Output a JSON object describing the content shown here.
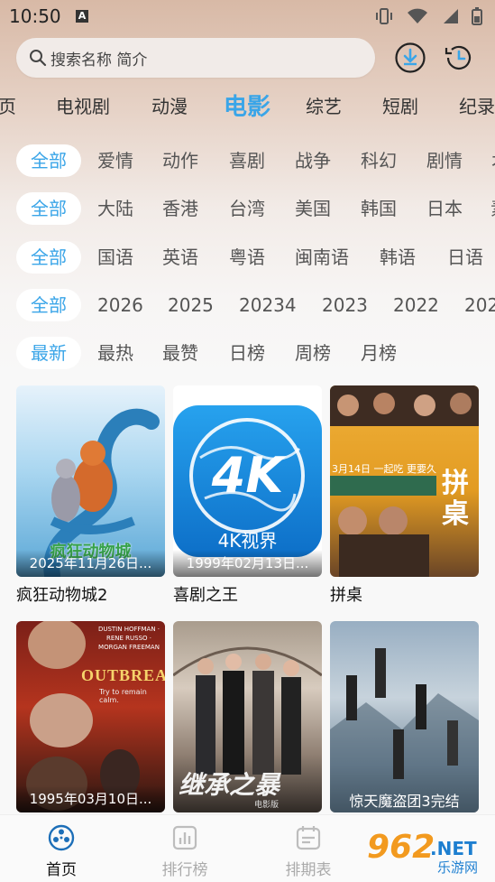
{
  "status": {
    "time": "10:50",
    "badge": "A"
  },
  "search": {
    "placeholder": "搜索名称 简介"
  },
  "categories": [
    "页",
    "电视剧",
    "动漫",
    "电影",
    "综艺",
    "短剧",
    "纪录"
  ],
  "category_active": "电影",
  "filters": {
    "genre": [
      "全部",
      "爱情",
      "动作",
      "喜剧",
      "战争",
      "科幻",
      "剧情",
      "オ"
    ],
    "region": [
      "全部",
      "大陆",
      "香港",
      "台湾",
      "美国",
      "韩国",
      "日本",
      "素"
    ],
    "language": [
      "全部",
      "国语",
      "英语",
      "粤语",
      "闽南语",
      "韩语",
      "日语"
    ],
    "year": [
      "全部",
      "2026",
      "2025",
      "20234",
      "2023",
      "2022",
      "202"
    ],
    "sort": [
      "最新",
      "最热",
      "最赞",
      "日榜",
      "周榜",
      "月榜"
    ]
  },
  "movies": [
    {
      "title": "疯狂动物城2",
      "date": "2025年11月26日...",
      "poster_text": "疯狂动物城",
      "colors": [
        "#9fd2ee",
        "#2a6ea8"
      ]
    },
    {
      "title": "喜剧之王",
      "date": "1999年02月13日...",
      "poster_text": "4K视界",
      "logo": "4K",
      "colors": [
        "#1e93e3",
        "#0b6cc4"
      ]
    },
    {
      "title": "拼桌",
      "date": "",
      "poster_text": "拼桌",
      "sub": "3月14日 一起吃 更要久",
      "colors": [
        "#e9a528",
        "#5a3a22"
      ]
    },
    {
      "title": "",
      "date": "1995年03月10日...",
      "poster_text": "OUTBREAK",
      "cast": "DUSTIN HOFFMAN · RENE RUSSO · MORGAN FREEMAN",
      "tagline": "Try to remain calm.",
      "colors": [
        "#b82a1c",
        "#1d1512"
      ]
    },
    {
      "title": "",
      "date": "",
      "poster_text": "继承之暴",
      "sub": "电影版",
      "colors": [
        "#cbbfb3",
        "#3c3430"
      ]
    },
    {
      "title": "",
      "date": "",
      "poster_text": "惊天魔盗团3完结",
      "colors": [
        "#6f88a0",
        "#26343f"
      ]
    }
  ],
  "nav": [
    {
      "label": "首页",
      "active": true
    },
    {
      "label": "排行榜",
      "active": false
    },
    {
      "label": "排期表",
      "active": false
    }
  ],
  "watermark": {
    "big": "962",
    "net": ".NET",
    "small": "乐游网"
  }
}
